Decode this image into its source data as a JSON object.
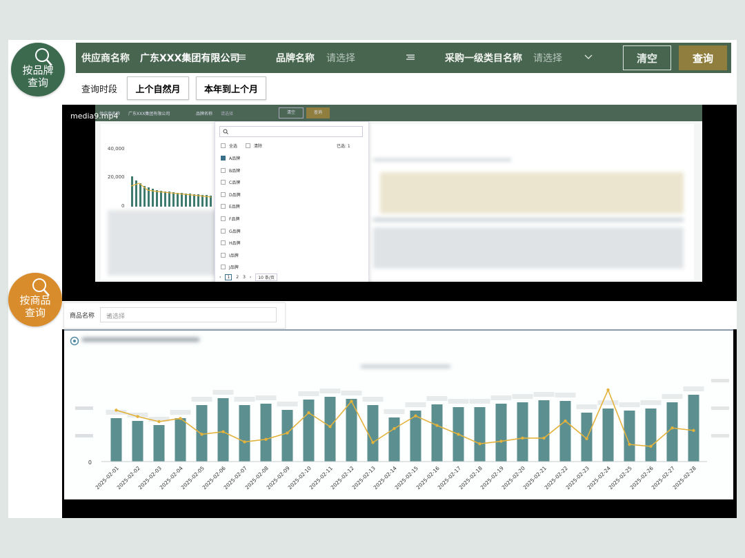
{
  "badges": {
    "brand": {
      "line1": "按品牌",
      "line2": "查询",
      "color": "#3b6a4f",
      "icon": "magnifier-icon"
    },
    "product": {
      "line1": "按商品",
      "line2": "查询",
      "color": "#d98c2b",
      "icon": "magnifier-icon"
    }
  },
  "filter": {
    "supplier_label": "供应商名称",
    "supplier_value": "广东XXX集团有限公司",
    "brand_label": "品牌名称",
    "brand_placeholder": "请选择",
    "category_label": "采购一级类目名称",
    "category_placeholder": "请选择",
    "clear_label": "清空",
    "query_label": "查询"
  },
  "period": {
    "label": "查询时段",
    "options": [
      "上个自然月",
      "本年到上个月"
    ]
  },
  "video": {
    "filename": "media9.mp4",
    "mini_bar": {
      "supplier_label": "供应商名称",
      "supplier_value": "广东XXX集团有限公司",
      "brand_label": "品牌名称",
      "placeholder": "请选择",
      "clear": "清空",
      "query": "查询"
    },
    "y_ticks": [
      "40,000",
      "20,000",
      "0"
    ],
    "dropdown": {
      "select_all": "全选",
      "invert": "清除",
      "selected": "已选: 1",
      "items": [
        "A品牌",
        "B品牌",
        "C品牌",
        "D品牌",
        "E品牌",
        "F品牌",
        "G品牌",
        "H品牌",
        "I品牌",
        "J品牌"
      ],
      "checked_index": 0,
      "pages": [
        "1",
        "2",
        "3"
      ],
      "page_size": "10 条/页"
    }
  },
  "product": {
    "label": "商品名称",
    "placeholder": "请选择"
  },
  "chart_data": {
    "type": "bar",
    "categories": [
      "2025-02-01",
      "2025-02-02",
      "2025-02-03",
      "2025-02-04",
      "2025-02-05",
      "2025-02-06",
      "2025-02-07",
      "2025-02-08",
      "2025-02-09",
      "2025-02-10",
      "2025-02-11",
      "2025-02-12",
      "2025-02-13",
      "2025-02-14",
      "2025-02-15",
      "2025-02-16",
      "2025-02-17",
      "2025-02-18",
      "2025-02-19",
      "2025-02-20",
      "2025-02-21",
      "2025-02-22",
      "2025-02-23",
      "2025-02-24",
      "2025-02-25",
      "2025-02-26",
      "2025-02-27",
      "2025-02-28"
    ],
    "series": [
      {
        "type": "bar",
        "color": "#5b8f90",
        "values": [
          63,
          59,
          53,
          63,
          82,
          92,
          82,
          84,
          75,
          90,
          94,
          91,
          82,
          64,
          74,
          83,
          79,
          79,
          84,
          86,
          89,
          88,
          71,
          77,
          74,
          77,
          86,
          97
        ]
      },
      {
        "type": "line",
        "color": "#e3b23c",
        "values": [
          68,
          58,
          50,
          55,
          30,
          34,
          18,
          22,
          32,
          64,
          42,
          82,
          17,
          39,
          59,
          44,
          30,
          15,
          19,
          24,
          24,
          51,
          23,
          100,
          14,
          11,
          40,
          36
        ]
      }
    ],
    "y_tick_labels": [
      "0"
    ],
    "grid": false
  }
}
